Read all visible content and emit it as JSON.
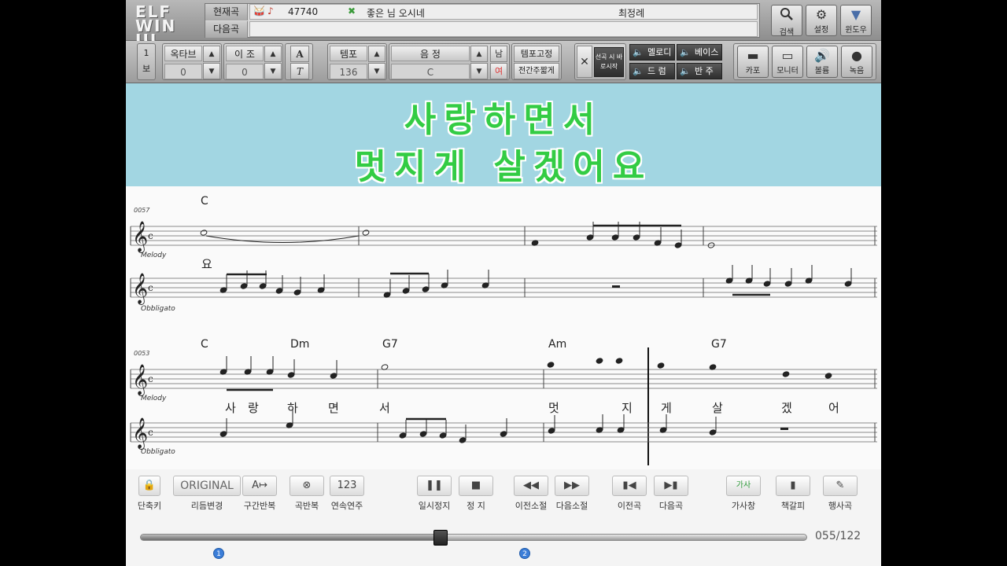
{
  "header": {
    "logo": "ELF WIN III",
    "current_label": "현재곡",
    "next_label": "다음곡",
    "current_number": "47740",
    "current_title": "좋은 님 오시네",
    "current_artist": "최정례",
    "next_title": ""
  },
  "top_buttons": [
    {
      "label": "검색",
      "icon": "search-icon"
    },
    {
      "label": "설정",
      "icon": "gear-icon"
    },
    {
      "label": "윈도우",
      "icon": "window-icon"
    }
  ],
  "controls": {
    "part_top": "1",
    "part_bottom": "보",
    "octave_label": "옥타브",
    "octave_value": "0",
    "transpose_label": "이 조",
    "transpose_value": "0",
    "tempo_label": "템포",
    "tempo_value": "136",
    "key_label": "음 정",
    "key_value": "C",
    "gender_male": "남",
    "gender_female": "여",
    "tempo_fix": "템포고정",
    "interlude_skip": "전간주짧게",
    "select_start": "선곡 시 바로시작",
    "mix": [
      "멜로디",
      "베이스",
      "드 럼",
      "반 주"
    ],
    "right_buttons": [
      "카포",
      "모니터",
      "볼륨",
      "녹음"
    ]
  },
  "lyrics_banner": {
    "line1": "사랑하면서",
    "line2": "멋지게 살겠어요"
  },
  "score": {
    "system1": {
      "measure_no": "0057",
      "chords": [
        "C"
      ],
      "melody_label": "Melody",
      "obbligato_label": "Obbligato",
      "lyric": "요"
    },
    "system2": {
      "measure_no": "0053",
      "chords": [
        "C",
        "Dm",
        "G7",
        "Am",
        "G7"
      ],
      "melody_label": "Melody",
      "obbligato_label": "Obbligato",
      "lyrics": [
        "사",
        "랑",
        "하",
        "면",
        "서",
        "멋",
        "지",
        "게",
        "살",
        "겠",
        "어"
      ]
    }
  },
  "bottom_buttons": [
    {
      "label": "단축키",
      "icon": "lock-icon"
    },
    {
      "label": "리듬변경",
      "icon": "original-icon",
      "text": "ORIGINAL"
    },
    {
      "label": "구간반복",
      "icon": "section-repeat-icon"
    },
    {
      "label": "곡반복",
      "icon": "song-repeat-icon"
    },
    {
      "label": "연속연주",
      "icon": "continuous-play-icon",
      "text": "123"
    },
    {
      "label": "일시정지",
      "icon": "pause-icon"
    },
    {
      "label": "정 지",
      "icon": "stop-icon"
    },
    {
      "label": "이전소절",
      "icon": "rewind-icon"
    },
    {
      "label": "다음소절",
      "icon": "fast-forward-icon"
    },
    {
      "label": "이전곡",
      "icon": "previous-track-icon"
    },
    {
      "label": "다음곡",
      "icon": "next-track-icon"
    },
    {
      "label": "가사창",
      "icon": "lyrics-window-icon",
      "text": "가사"
    },
    {
      "label": "책갈피",
      "icon": "bookmark-icon"
    },
    {
      "label": "행사곡",
      "icon": "event-song-icon"
    }
  ],
  "progress": {
    "label": "055/122",
    "current": 55,
    "total": 122,
    "markers": [
      "1",
      "2"
    ]
  }
}
